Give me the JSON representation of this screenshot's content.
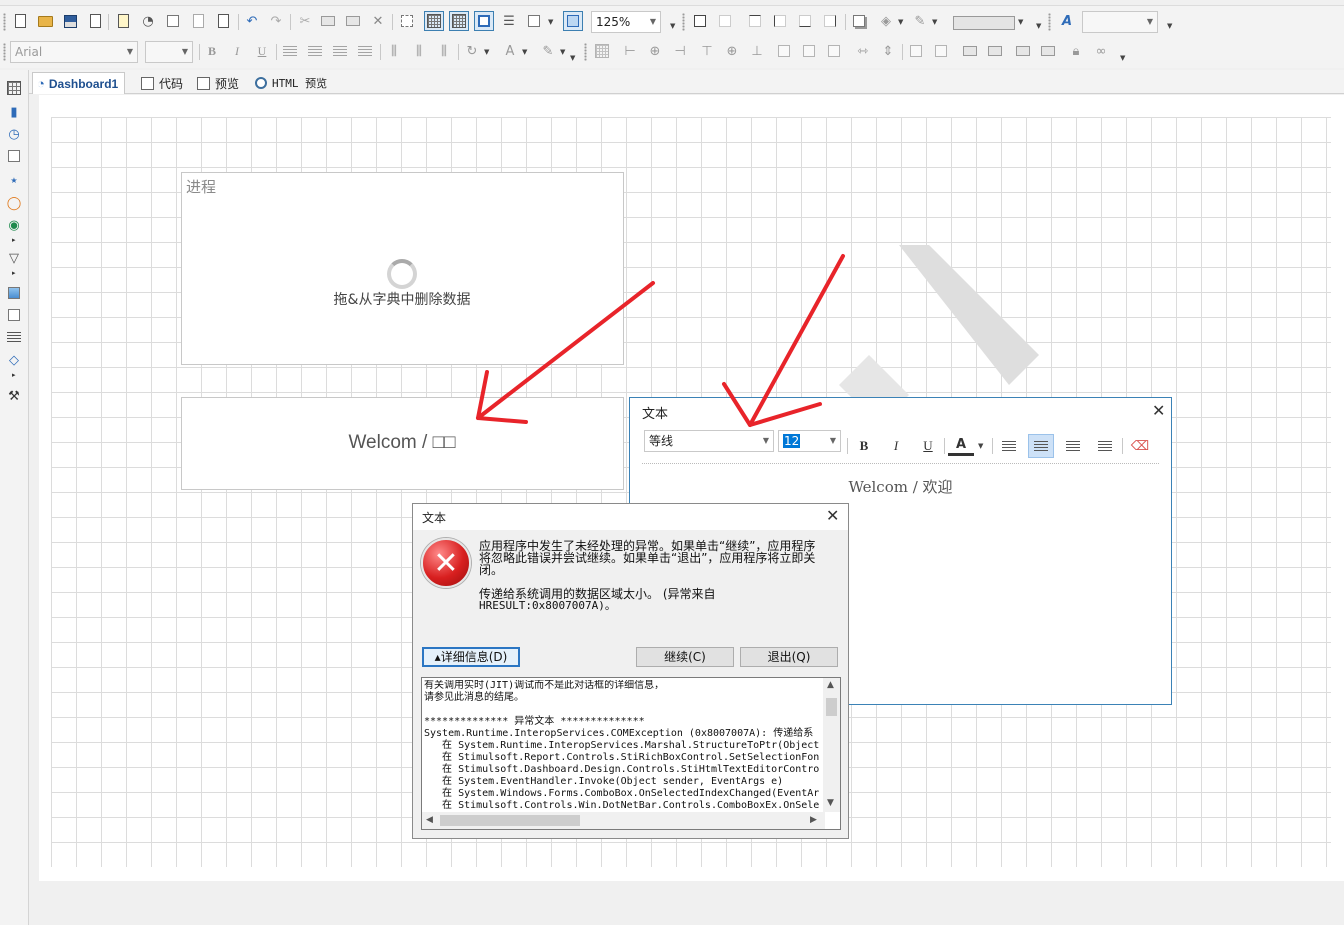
{
  "toolbar1": {
    "zoom": "125%"
  },
  "toolbar2": {
    "font_family": "Arial",
    "font_size": "",
    "bold": "B",
    "italic": "I",
    "underline": "U"
  },
  "tabs": [
    {
      "label": "Dashboard1"
    },
    {
      "label": "代码"
    },
    {
      "label": "预览"
    },
    {
      "label": "HTML 预览"
    }
  ],
  "progress_widget": {
    "title": "进程",
    "hint": "拖&从字典中删除数据"
  },
  "text_widget": {
    "text": "Welcom / □□"
  },
  "text_editor": {
    "title": "文本",
    "font": "等线",
    "font_size": "12",
    "bold": "B",
    "italic": "I",
    "underline": "U",
    "font_color_letter": "A",
    "content": "Welcom / 欢迎"
  },
  "error_dialog": {
    "title": "文本",
    "message": "应用程序中发生了未经处理的异常。如果单击“继续”，应用程序将忽略此错误并尝试继续。如果单击“退出”，应用程序将立即关闭。",
    "detail": "传递给系统调用的数据区域太小。 (异常来自",
    "hresult": "HRESULT:0x8007007A)。",
    "details_button": "▴详细信息(D)",
    "continue_button": "继续(C)",
    "quit_button": "退出(Q)",
    "details_lines": [
      "有关调用实时(JIT)调试而不是此对话框的详细信息，",
      "请参见此消息的结尾。",
      "",
      "************** 异常文本 **************",
      "System.Runtime.InteropServices.COMException (0x8007007A): 传递给系",
      "   在 System.Runtime.InteropServices.Marshal.StructureToPtr(Object",
      "   在 Stimulsoft.Report.Controls.StiRichBoxControl.SetSelectionFon",
      "   在 Stimulsoft.Dashboard.Design.Controls.StiHtmlTextEditorContro",
      "   在 System.EventHandler.Invoke(Object sender, EventArgs e)",
      "   在 System.Windows.Forms.ComboBox.OnSelectedIndexChanged(EventAr",
      "   在 Stimulsoft.Controls.Win.DotNetBar.Controls.ComboBoxEx.OnSele"
    ]
  },
  "colors": {
    "annotation_arrow": "#e8242a",
    "accent": "#2b76c3",
    "window_border": "#3b82b6"
  }
}
